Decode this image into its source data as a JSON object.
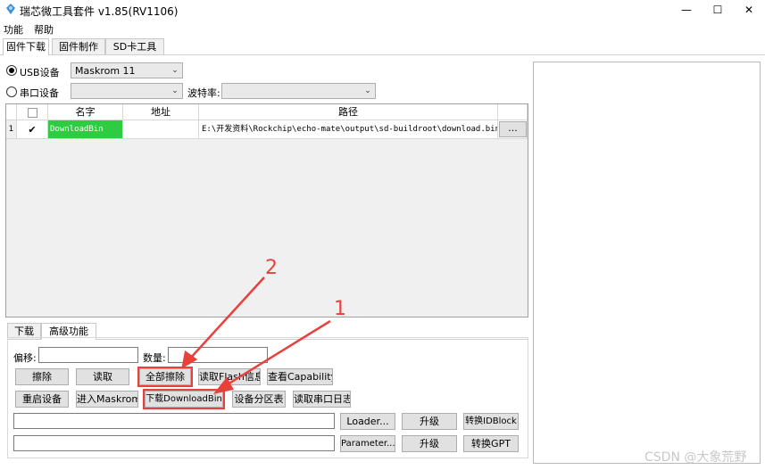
{
  "window": {
    "title": "瑞芯微工具套件 v1.85(RV1106)",
    "minimize": "—",
    "maximize": "☐",
    "close": "✕"
  },
  "menu": [
    "功能",
    "帮助"
  ],
  "tabs": [
    "固件下载",
    "固件制作",
    "SD卡工具"
  ],
  "usb": {
    "label": "USB设备",
    "selected": true,
    "device": "Maskrom  11"
  },
  "serial": {
    "label": "串口设备",
    "selected": false,
    "port": "",
    "baud_label": "波特率:",
    "baud": ""
  },
  "table": {
    "headers": [
      "名字",
      "地址",
      "路径"
    ],
    "rows": [
      {
        "index": "1",
        "checked": true,
        "check_glyph": "✔",
        "name": "DownloadBin",
        "address": "",
        "path": "E:\\开发资料\\Rockchip\\echo-mate\\output\\sd-buildroot\\download.bin",
        "browse": "..."
      }
    ]
  },
  "bottom_tabs": [
    "下载",
    "高级功能"
  ],
  "advanced": {
    "offset_label": "偏移:",
    "offset_value": "",
    "count_label": "数量:",
    "count_value": "",
    "row1": [
      "擦除",
      "读取",
      "全部擦除",
      "读取Flash信息",
      "查看Capability"
    ],
    "row2": [
      "重启设备",
      "进入Maskrom",
      "下载DownloadBin",
      "设备分区表",
      "读取串口日志"
    ],
    "loader_value": "",
    "loader_button": "Loader...",
    "loader_upgrade": "升级",
    "loader_convert": "转换IDBlock",
    "param_value": "",
    "param_button": "Parameter...",
    "param_upgrade": "升级",
    "param_convert": "转换GPT"
  },
  "annotations": {
    "arrow1": "1",
    "arrow2": "2",
    "color": "#e8413c"
  },
  "watermark": "CSDN @大象荒野"
}
